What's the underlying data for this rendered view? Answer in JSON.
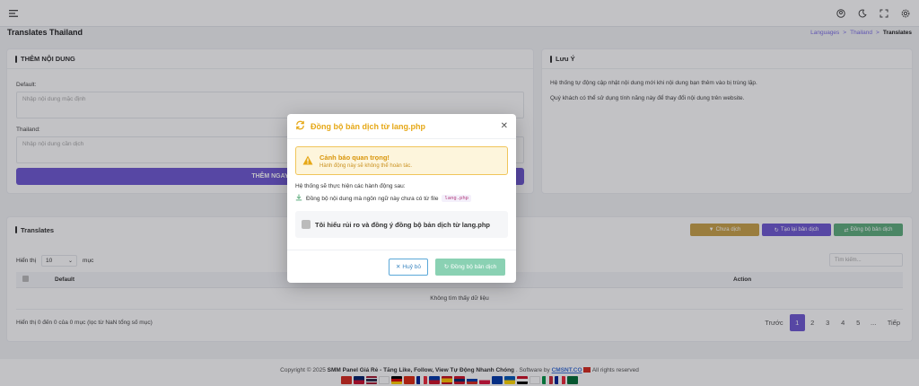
{
  "header": {
    "page_title": "Translates Thailand"
  },
  "breadcrumb": {
    "items": [
      "Languages",
      "Thailand",
      "Translates"
    ],
    "sep": ">"
  },
  "add_card": {
    "title": "THÊM NỘI DUNG",
    "default_label": "Default:",
    "default_placeholder": "Nhập nội dung mặc định",
    "thai_label": "Thailand:",
    "thai_placeholder": "Nhập nội dung cần dịch",
    "submit_label": "THÊM NGAY"
  },
  "notice_card": {
    "title": "Lưu Ý",
    "line1": "Hệ thống tự động cập nhật nội dung mới khi nội dung bạn thêm vào bị trùng lặp.",
    "line2": "Quý khách có thể sử dụng tính năng này để thay đổi nội dung trên website."
  },
  "translates_card": {
    "title": "Translates",
    "btn_untranslated": "Chưa dịch",
    "btn_retranslate": "Tạo lại bản dịch",
    "btn_sync": "Đồng bộ bản dịch",
    "show_label": "Hiển thị",
    "show_value": "10",
    "show_suffix": "mục",
    "search_placeholder": "Tìm kiếm...",
    "columns": [
      "Default",
      "Action"
    ],
    "empty_text": "Không tìm thấy dữ liệu",
    "info_text": "Hiển thị 0 đến 0 của 0 mục (lọc từ NaN tổng số mục)",
    "pagination": [
      "Trước",
      "1",
      "2",
      "3",
      "4",
      "5",
      "...",
      "Tiếp"
    ]
  },
  "footer": {
    "copyright": "Copyright © 2025",
    "site": "SMM Panel Giá Rẻ - Tăng Like, Follow, View Tự Động Nhanh Chóng",
    "software_by": ". Software by",
    "brand": "CMSNT.CO",
    "rights": "All rights reserved"
  },
  "modal": {
    "title": "Đồng bộ bản dịch từ lang.php",
    "warn_title": "Cảnh báo quan trọng!",
    "warn_sub": "Hành động này sẽ không thể hoàn tác.",
    "intro": "Hệ thống sẽ thực hiện các hành động sau:",
    "action_item": "Đồng bộ nội dung mà ngôn ngữ này chưa có từ file",
    "file_code": "lang.php",
    "agree_text": "Tôi hiểu rủi ro và đồng ý đồng bộ bản dịch từ lang.php",
    "cancel_label": "Huỷ bỏ",
    "confirm_label": "Đồng bộ bản dịch"
  },
  "colors": {
    "primary": "#6f5ad3",
    "warning": "#e6a817",
    "success": "#5fae7e",
    "gold": "#c9a24a"
  }
}
